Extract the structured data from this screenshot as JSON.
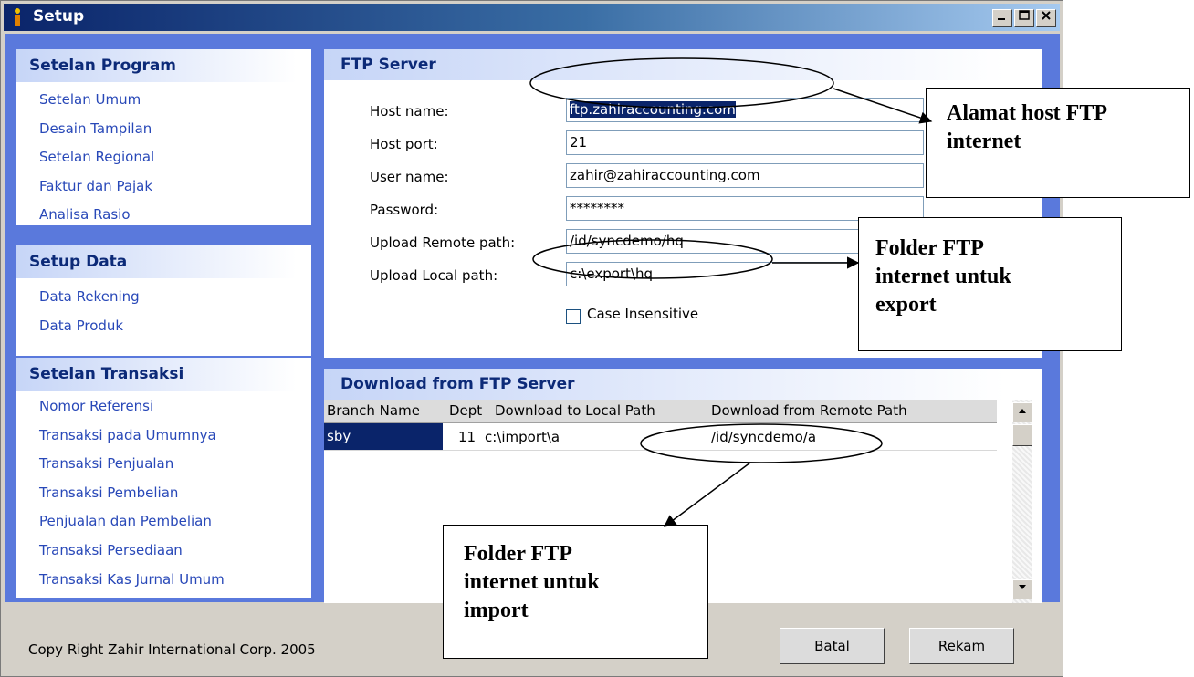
{
  "window": {
    "title": "Setup",
    "controls": [
      "minimize",
      "maximize",
      "close"
    ]
  },
  "sidebar": {
    "groups": [
      {
        "title": "Setelan Program",
        "items": [
          "Setelan Umum",
          "Desain Tampilan",
          "Setelan Regional",
          "Faktur dan Pajak",
          "Analisa Rasio"
        ]
      },
      {
        "title": "Setup Data",
        "items": [
          "Data Rekening",
          "Data Produk"
        ]
      },
      {
        "title": "Setelan Transaksi",
        "items": [
          "Nomor Referensi",
          "Transaksi pada Umumnya",
          "Transaksi Penjualan",
          "Transaksi Pembelian",
          "Penjualan dan Pembelian",
          "Transaksi Persediaan",
          "Transaksi Kas Jurnal Umum"
        ]
      }
    ]
  },
  "ftp": {
    "title": "FTP Server",
    "fields": [
      {
        "label": "Host name:",
        "value": "ftp.zahiraccounting.com"
      },
      {
        "label": "Host port:",
        "value": "21"
      },
      {
        "label": "User name:",
        "value": "zahir@zahiraccounting.com"
      },
      {
        "label": "Password:",
        "value": "********"
      },
      {
        "label": "Upload Remote path:",
        "value": "/id/syncdemo/hq"
      },
      {
        "label": "Upload Local path:",
        "value": "c:\\export\\hq"
      }
    ],
    "case_label": "Case Insensitive",
    "case_checked": false
  },
  "download": {
    "title": "Download from FTP Server",
    "columns": [
      "Branch Name",
      "Dept",
      "Download to Local Path",
      "Download from Remote Path"
    ],
    "rows": [
      {
        "branch": "sby",
        "dept": "11",
        "local": "c:\\import\\a",
        "remote": "/id/syncdemo/a"
      }
    ]
  },
  "footer": {
    "copyright": "Copy Right Zahir International Corp. 2005",
    "cancel_label": "Batal",
    "save_label": "Rekam"
  },
  "annotations": {
    "host": [
      "Alamat host FTP",
      "internet"
    ],
    "export": [
      "Folder FTP",
      "internet untuk",
      "export"
    ],
    "import": [
      "Folder FTP",
      "internet untuk",
      "import"
    ]
  }
}
